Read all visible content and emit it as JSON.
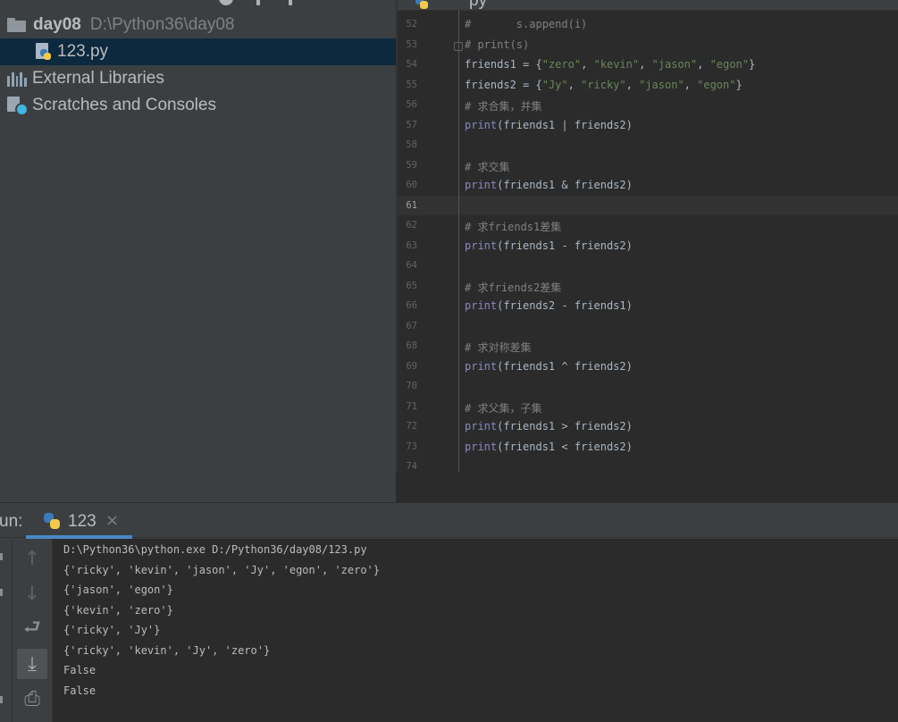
{
  "project": {
    "root": {
      "name": "day08",
      "path": "D:\\Python36\\day08"
    },
    "file": {
      "name": "123.py"
    },
    "external_libraries": "External Libraries",
    "scratches": "Scratches and Consoles"
  },
  "editor": {
    "tab_label": "py",
    "current_line": "61",
    "lines": [
      {
        "n": "52",
        "parts": [
          {
            "t": "#       s.append(i)",
            "c": "cm"
          }
        ]
      },
      {
        "n": "53",
        "parts": [
          {
            "t": "# print(s)",
            "c": "cm"
          }
        ]
      },
      {
        "n": "54",
        "parts": [
          {
            "t": "friends1 = {",
            "c": ""
          },
          {
            "t": "\"zero\"",
            "c": "st"
          },
          {
            "t": ", ",
            "c": ""
          },
          {
            "t": "\"kevin\"",
            "c": "st"
          },
          {
            "t": ", ",
            "c": ""
          },
          {
            "t": "\"jason\"",
            "c": "st"
          },
          {
            "t": ", ",
            "c": ""
          },
          {
            "t": "\"egon\"",
            "c": "st"
          },
          {
            "t": "}",
            "c": ""
          }
        ]
      },
      {
        "n": "55",
        "parts": [
          {
            "t": "friends2 = {",
            "c": ""
          },
          {
            "t": "\"Jy\"",
            "c": "st"
          },
          {
            "t": ", ",
            "c": ""
          },
          {
            "t": "\"ricky\"",
            "c": "st"
          },
          {
            "t": ", ",
            "c": ""
          },
          {
            "t": "\"jason\"",
            "c": "st"
          },
          {
            "t": ", ",
            "c": ""
          },
          {
            "t": "\"egon\"",
            "c": "st"
          },
          {
            "t": "}",
            "c": ""
          }
        ]
      },
      {
        "n": "56",
        "parts": [
          {
            "t": "# 求合集，并集",
            "c": "cm"
          }
        ]
      },
      {
        "n": "57",
        "parts": [
          {
            "t": "print",
            "c": "fn"
          },
          {
            "t": "(friends1 | friends2)",
            "c": ""
          }
        ]
      },
      {
        "n": "58",
        "parts": []
      },
      {
        "n": "59",
        "parts": [
          {
            "t": "# 求交集",
            "c": "cm"
          }
        ]
      },
      {
        "n": "60",
        "parts": [
          {
            "t": "print",
            "c": "fn"
          },
          {
            "t": "(friends1 & friends2)",
            "c": ""
          }
        ]
      },
      {
        "n": "61",
        "parts": []
      },
      {
        "n": "62",
        "parts": [
          {
            "t": "# 求friends1差集",
            "c": "cm"
          }
        ]
      },
      {
        "n": "63",
        "parts": [
          {
            "t": "print",
            "c": "fn"
          },
          {
            "t": "(friends1 - friends2)",
            "c": ""
          }
        ]
      },
      {
        "n": "64",
        "parts": []
      },
      {
        "n": "65",
        "parts": [
          {
            "t": "# 求friends2差集",
            "c": "cm"
          }
        ]
      },
      {
        "n": "66",
        "parts": [
          {
            "t": "print",
            "c": "fn"
          },
          {
            "t": "(friends2 - friends1)",
            "c": ""
          }
        ]
      },
      {
        "n": "67",
        "parts": []
      },
      {
        "n": "68",
        "parts": [
          {
            "t": "# 求对称差集",
            "c": "cm"
          }
        ]
      },
      {
        "n": "69",
        "parts": [
          {
            "t": "print",
            "c": "fn"
          },
          {
            "t": "(friends1 ^ friends2)",
            "c": ""
          }
        ]
      },
      {
        "n": "70",
        "parts": []
      },
      {
        "n": "71",
        "parts": [
          {
            "t": "# 求父集，子集",
            "c": "cm"
          }
        ]
      },
      {
        "n": "72",
        "parts": [
          {
            "t": "print",
            "c": "fn"
          },
          {
            "t": "(friends1 > friends2)",
            "c": ""
          }
        ]
      },
      {
        "n": "73",
        "parts": [
          {
            "t": "print",
            "c": "fn"
          },
          {
            "t": "(friends1 < friends2)",
            "c": ""
          }
        ]
      },
      {
        "n": "74",
        "parts": []
      }
    ]
  },
  "run": {
    "title": "un:",
    "tab_label": "123",
    "close_glyph": "×",
    "tools": [
      {
        "name": "rerun-up-icon",
        "glyph": "↑"
      },
      {
        "name": "scroll-down-icon",
        "glyph": "↓"
      },
      {
        "name": "soft-wrap-icon",
        "glyph": "⮐"
      },
      {
        "name": "scroll-to-end-icon",
        "glyph": "⤓"
      },
      {
        "name": "print-icon",
        "glyph": "⎙"
      }
    ],
    "output": [
      "D:\\Python36\\python.exe D:/Python36/day08/123.py",
      "{'ricky', 'kevin', 'jason', 'Jy', 'egon', 'zero'}",
      "{'jason', 'egon'}",
      "{'kevin', 'zero'}",
      "{'ricky', 'Jy'}",
      "{'ricky', 'kevin', 'Jy', 'zero'}",
      "False",
      "False"
    ]
  },
  "colors": {
    "selection": "#0d293e",
    "tab_underline": "#4a88c7",
    "python_blue": "#3d7ab8",
    "python_yellow": "#f2c94c",
    "string_green": "#6a8759",
    "builtin_purple": "#8888c6",
    "comment_gray": "#808080"
  }
}
